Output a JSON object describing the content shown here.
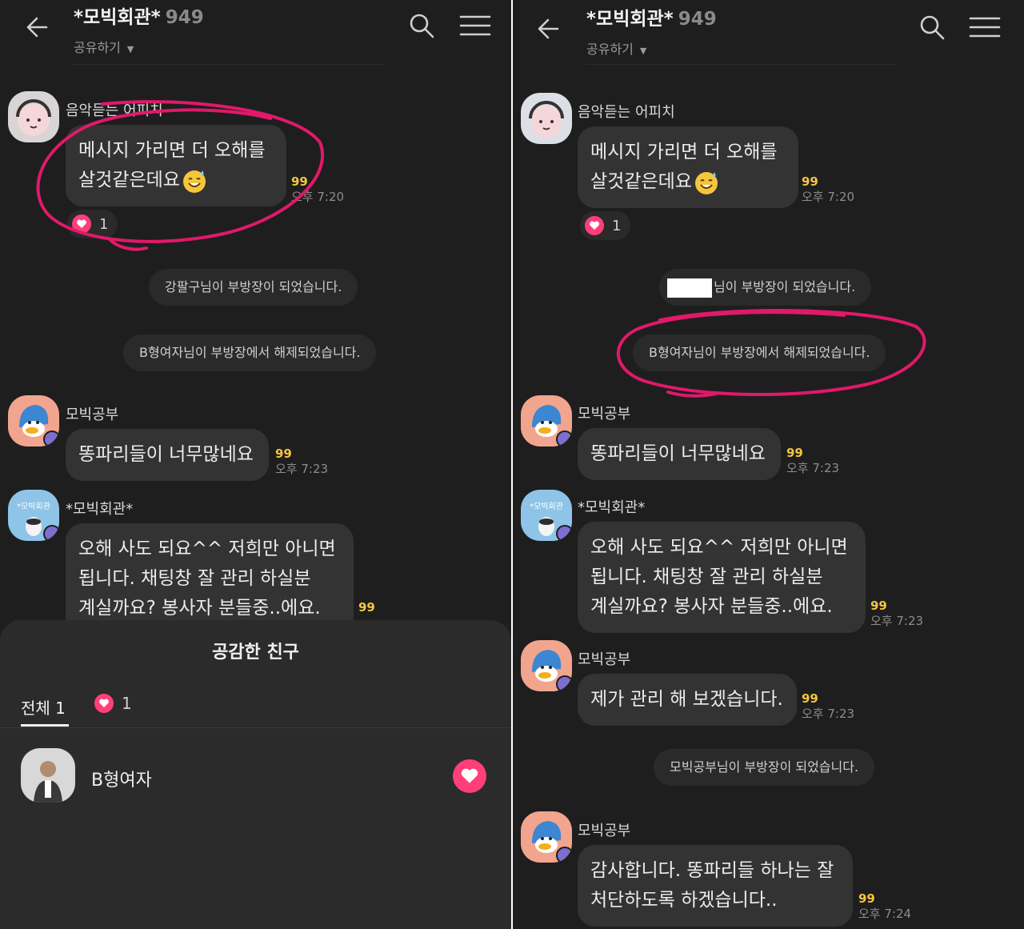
{
  "colors": {
    "background": "#1e1e1e",
    "bubble": "#333334",
    "unread": "#f4c542",
    "heart": "#ff3f7a",
    "annotation": "#e0196a"
  },
  "header": {
    "title": "*모빅회관*",
    "member_count": "949",
    "share_label": "공유하기"
  },
  "senders": {
    "apeach": "음악듣는 어피치",
    "study": "모빅공부",
    "hall": "*모빅회관*"
  },
  "left": {
    "msg1": {
      "line1": "메시지 가리면 더 오해를",
      "line2": "살것같은데요",
      "unread": "99",
      "time": "오후 7:20"
    },
    "reaction_count": "1",
    "system1": "강팔구님이 부방장이 되었습니다.",
    "system2": "B형여자님이 부방장에서 해제되었습니다.",
    "msg2": {
      "text": "똥파리들이 너무많네요",
      "unread": "99",
      "time": "오후 7:23"
    },
    "msg3": {
      "line1": "오해 사도 되요^^  저희만 아니면",
      "line2": "됩니다. 채팅창 잘 관리 하실분",
      "line3": "계실까요? 봉사자 분들중..에요.",
      "unread": "99"
    },
    "sheet": {
      "title": "공감한 친구",
      "tab_all": "전체",
      "tab_all_count": "1",
      "tab_heart_count": "1",
      "friend_name": "B형여자"
    }
  },
  "right": {
    "msg1": {
      "line1": "메시지 가리면 더 오해를",
      "line2": "살것같은데요",
      "unread": "99",
      "time": "오후 7:20"
    },
    "reaction_count": "1",
    "system1": "님이 부방장이 되었습니다.",
    "system2": "B형여자님이 부방장에서 해제되었습니다.",
    "msg2": {
      "text": "똥파리들이 너무많네요",
      "unread": "99",
      "time": "오후 7:23"
    },
    "msg3": {
      "line1": "오해 사도 되요^^  저희만 아니면",
      "line2": "됩니다. 채팅창 잘 관리 하실분",
      "line3": "계실까요? 봉사자 분들중..에요.",
      "unread": "99",
      "time": "오후 7:23"
    },
    "msg4": {
      "text": "제가 관리 해 보겠습니다.",
      "unread": "99",
      "time": "오후 7:23"
    },
    "system3": "모빅공부님이 부방장이 되었습니다.",
    "msg5": {
      "line1": "감사합니다. 똥파리들 하나는 잘",
      "line2": "처단하도록 하겠습니다..",
      "unread": "99",
      "time": "오후 7:24"
    }
  },
  "icons": [
    "back-arrow-icon",
    "search-icon",
    "menu-icon",
    "heart-icon",
    "emoji-icon",
    "crown-icon"
  ]
}
